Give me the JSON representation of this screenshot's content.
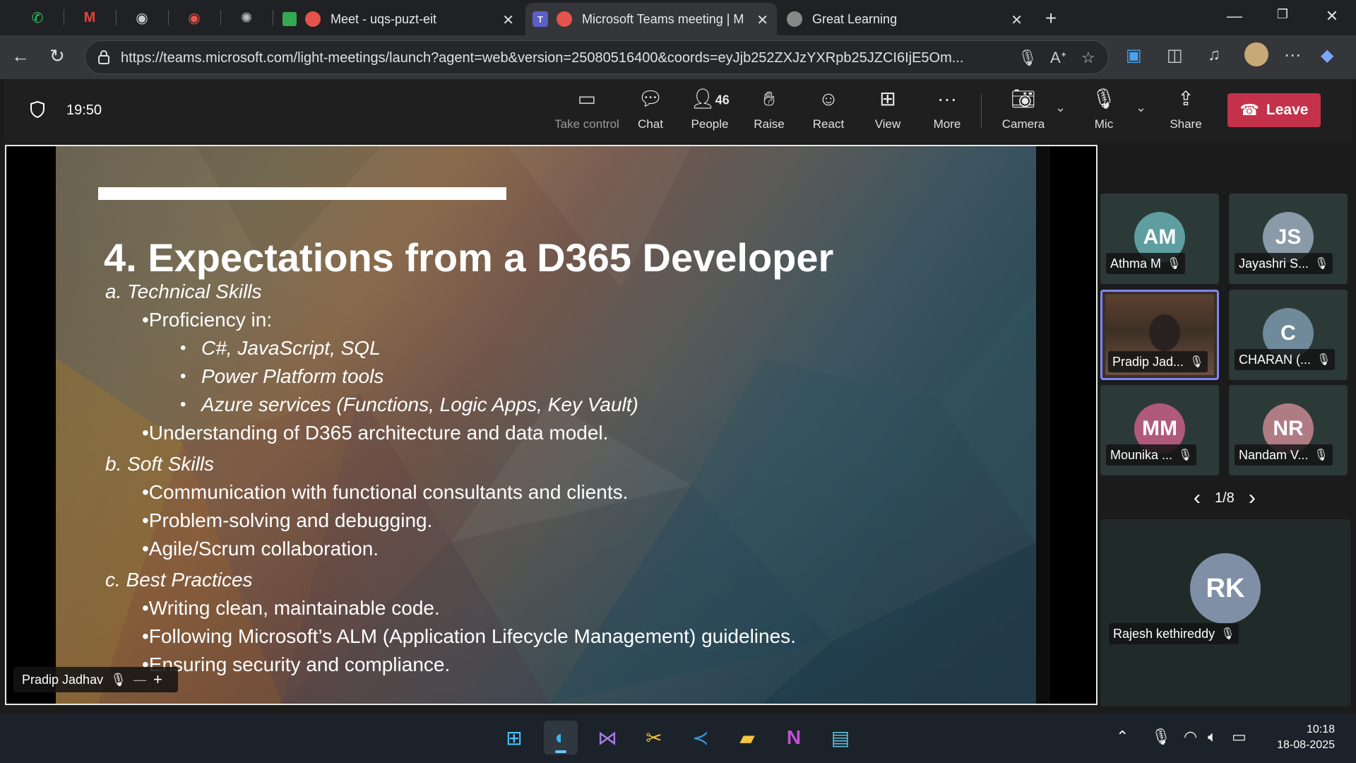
{
  "browser": {
    "tabs": [
      {
        "title": "Meet - uqs-puzt-eit",
        "active": false
      },
      {
        "title": "Microsoft Teams meeting | M",
        "active": true
      },
      {
        "title": "Great Learning",
        "active": false
      }
    ],
    "new_tab": "+",
    "url": "https://teams.microsoft.com/light-meetings/launch?agent=web&version=25080516400&coords=eyJjb252ZXJzYXRpb25JZCI6IjE5Om...",
    "icons": [
      "whatsapp-icon",
      "gmail-icon",
      "github-icon",
      "record-icon",
      "chatgpt-icon"
    ]
  },
  "meeting": {
    "timer": "19:50",
    "controls": {
      "take_control": "Take control",
      "chat": "Chat",
      "people": "People",
      "people_count": "46",
      "raise": "Raise",
      "react": "React",
      "view": "View",
      "more": "More",
      "camera": "Camera",
      "mic": "Mic",
      "share": "Share",
      "leave": "Leave"
    }
  },
  "slide": {
    "title": "4. Expectations from a D365 Developer",
    "lines": [
      "a. Technical Skills",
      "•Proficiency in:",
      "C#, JavaScript, SQL",
      "Power Platform tools",
      "Azure services (Functions, Logic Apps, Key Vault)",
      "•Understanding of D365 architecture and data model.",
      "b. Soft Skills",
      "•Communication with functional consultants and clients.",
      "•Problem-solving and debugging.",
      "•Agile/Scrum collaboration.",
      "c. Best Practices",
      "•Writing clean, maintainable code.",
      "•Following Microsoft’s ALM (Application Lifecycle Management) guidelines.",
      "•Ensuring security and compliance."
    ],
    "bullet": "•"
  },
  "presenter": {
    "name": "Pradip Jadhav",
    "minus": "—",
    "plus": "+"
  },
  "participants": [
    {
      "initials": "AM",
      "name": "Athma M",
      "color": "#5f9ea0"
    },
    {
      "initials": "JS",
      "name": "Jayashri S...",
      "color": "#8a9aa8"
    },
    {
      "initials": "",
      "name": "Pradip Jad...",
      "color": "#5a4030"
    },
    {
      "initials": "C",
      "name": "CHARAN (...",
      "color": "#6f8a9a"
    },
    {
      "initials": "MM",
      "name": "Mounika ...",
      "color": "#b05a7a"
    },
    {
      "initials": "NR",
      "name": "Nandam V...",
      "color": "#b07c84"
    }
  ],
  "pager": {
    "text": "1/8",
    "prev": "‹",
    "next": "›"
  },
  "featured": {
    "initials": "RK",
    "name": "Rajesh kethireddy",
    "color": "#7f8fa6"
  },
  "taskbar": {
    "apps": [
      "windows-start-icon",
      "edge-icon",
      "visual-studio-icon",
      "snipping-icon",
      "vscode-icon",
      "file-explorer-icon",
      "onenote-icon",
      "remote-desktop-icon"
    ],
    "time": "10:18",
    "date": "18-08-2025"
  }
}
